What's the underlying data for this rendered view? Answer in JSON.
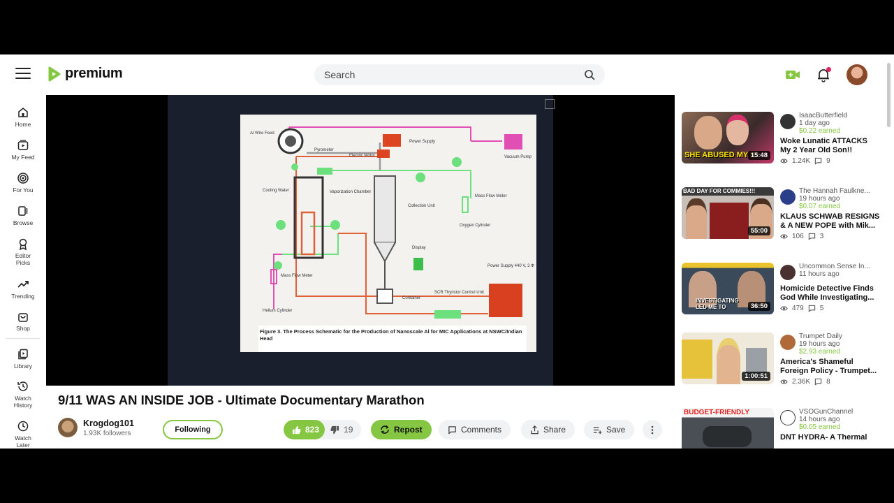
{
  "brand": {
    "name": "premium",
    "accent": "#85c742"
  },
  "search": {
    "placeholder": "Search"
  },
  "nav": [
    {
      "label": "Home",
      "icon": "home-icon"
    },
    {
      "label": "My Feed",
      "icon": "feed-icon"
    },
    {
      "label": "For You",
      "icon": "target-icon"
    },
    {
      "label": "Browse",
      "icon": "browse-icon"
    },
    {
      "label": "Editor Picks",
      "icon": "award-icon"
    },
    {
      "label": "Trending",
      "icon": "trending-icon"
    },
    {
      "label": "Shop",
      "icon": "bag-icon"
    },
    {
      "label": "Library",
      "icon": "library-icon"
    },
    {
      "label": "Watch History",
      "icon": "history-icon"
    },
    {
      "label": "Watch Later",
      "icon": "clock-icon"
    }
  ],
  "video": {
    "title": "9/11 WAS AN INSIDE JOB - Ultimate Documentary Marathon",
    "channel": "Krogdog101",
    "followers": "1.93K followers",
    "follow_label": "Following",
    "likes": "823",
    "dislikes": "19",
    "repost_label": "Repost",
    "comments_label": "Comments",
    "share_label": "Share",
    "save_label": "Save"
  },
  "slide": {
    "labels": {
      "al_wire": "Al Wire Feed",
      "power_top": "Power Supply",
      "pyrometer": "Pyrometer",
      "electric_motor": "Electric Motor",
      "vacuum": "Vacuum Pump",
      "cooling": "Cooling Water",
      "vaporization": "Vaporization Chamber",
      "collection": "Collection Unit",
      "mass_flow_right": "Mass Flow Meter",
      "oxygen": "Oxygen Cylinder",
      "display": "Display",
      "power_bottom": "Power Supply 440 V, 3 Φ",
      "mass_flow_left": "Mass Flow Meter",
      "helium": "Helium Cylinder",
      "container": "Container",
      "scr": "SCR Thyristor Control Unit"
    },
    "caption": "Figure 3. The Process Schematic for the Production of Nanoscale Al for MIC Applications at NSWC/Indian Head"
  },
  "recommendations": [
    {
      "channel": "IsaacButterfield",
      "time": "1 day ago",
      "earned": "$0.22 earned",
      "title": "Woke Lunatic ATTACKS My 2 Year Old Son!!",
      "views": "1.24K",
      "comments": "9",
      "duration": "15:48",
      "thumb_text": "SHE ABUSED MY KI",
      "thumb_color": "#6a4a3a"
    },
    {
      "channel": "The Hannah Faulkne...",
      "time": "19 hours ago",
      "earned": "$0.07 earned",
      "title": "KLAUS SCHWAB RESIGNS & A NEW POPE with Mik...",
      "views": "106",
      "comments": "3",
      "duration": "55:00",
      "thumb_text": "BAD DAY FOR COMMIES!!!",
      "thumb_color": "#7a2a2a"
    },
    {
      "channel": "Uncommon Sense In...",
      "time": "11 hours ago",
      "earned": "",
      "title": "Homicide Detective Finds God While Investigating...",
      "views": "479",
      "comments": "5",
      "duration": "36:50",
      "thumb_text": "INVESTIGATING LED ME TO",
      "thumb_color": "#3a4a5a"
    },
    {
      "channel": "Trumpet Daily",
      "time": "19 hours ago",
      "earned": "$2.93 earned",
      "title": "America's Shameful Foreign Policy - Trumpet...",
      "views": "2.36K",
      "comments": "8",
      "duration": "1:00:51",
      "thumb_text": "",
      "thumb_color": "#d8c25a"
    },
    {
      "channel": "VSOGunChannel",
      "time": "14 hours ago",
      "earned": "$0.05 earned",
      "title": "DNT HYDRA- A Thermal",
      "views": "",
      "comments": "",
      "duration": "",
      "thumb_text": "BUDGET-FRIENDLY",
      "thumb_color": "#4a4f55"
    }
  ]
}
